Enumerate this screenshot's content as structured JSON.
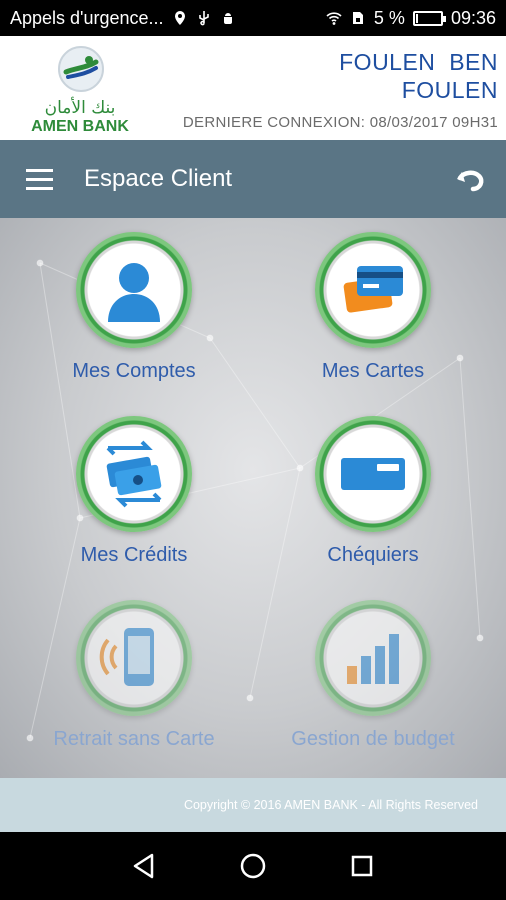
{
  "status_bar": {
    "notification": "Appels d'urgence...",
    "battery_text": "5 %",
    "battery_level": 0.05,
    "time": "09:36"
  },
  "header": {
    "logo_arabic": "بنك الأمان",
    "logo_name": "AMEN BANK",
    "user_first": "FOULEN  BEN",
    "user_last": "FOULEN",
    "last_connection": "DERNIERE CONNEXION: 08/03/2017 09H31"
  },
  "toolbar": {
    "title": "Espace Client",
    "menu_icon": "hamburger-menu-icon",
    "back_icon": "undo-back-icon"
  },
  "tiles": [
    {
      "label": "Mes Comptes",
      "icon": "user-account-icon"
    },
    {
      "label": "Mes Cartes",
      "icon": "credit-cards-icon"
    },
    {
      "label": "Mes Crédits",
      "icon": "money-transfer-icon"
    },
    {
      "label": "Chéquiers",
      "icon": "checkbook-card-icon"
    },
    {
      "label": "Retrait sans Carte",
      "icon": "mobile-withdrawal-icon"
    },
    {
      "label": "Gestion de budget",
      "icon": "bar-chart-icon"
    }
  ],
  "footer": {
    "copyright": "Copyright © 2016 AMEN BANK - All Rights Reserved"
  },
  "colors": {
    "toolbar": "#5a7585",
    "brand_green": "#2e8b3a",
    "label_blue": "#2f5cab",
    "footer": "#c8d9df"
  }
}
